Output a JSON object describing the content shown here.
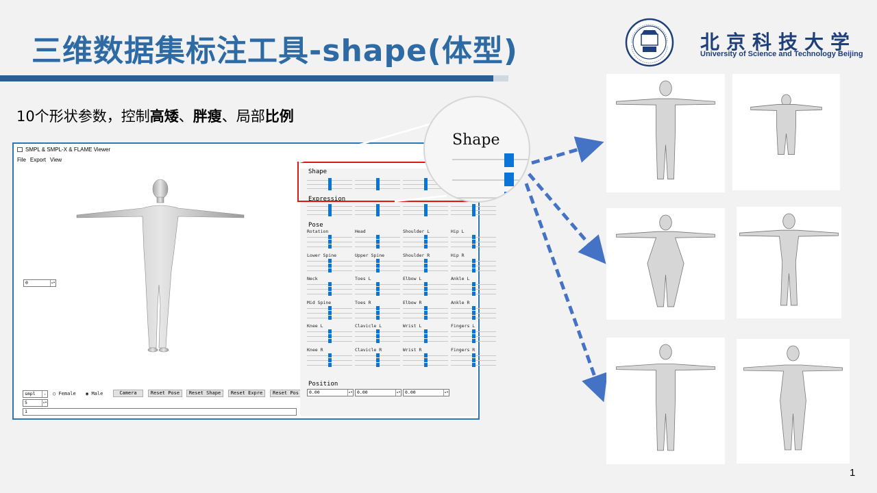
{
  "slide": {
    "title": "三维数据集标注工具-shape(体型)",
    "subtitle_parts": [
      "10个形状参数，控制",
      "高矮",
      "、",
      "胖瘦",
      "、局部",
      "比例"
    ],
    "page_number": "1"
  },
  "university": {
    "name_cn": "北京科技大学",
    "name_en": "University of Science and Technology Beijing",
    "seal_text": "北京科技大学 · 1952 · UNIVERSITY OF SCIENCE AND TECHNOLOGY BEIJING",
    "seal_center": "求实鼎新"
  },
  "app": {
    "window_title": "SMPL & SMPL-X & FLAME Viewer",
    "menu": [
      "File",
      "Export",
      "View"
    ],
    "frame_spin_value": "0",
    "model_select": "smpl",
    "gender_female": "Female",
    "gender_male": "Male",
    "buttons": [
      "Camera",
      "Reset Pose",
      "Reset Shape",
      "Reset Expre",
      "Reset Pos"
    ],
    "small_spin_value": "5",
    "text_field_value": "1",
    "shape_label": "Shape",
    "expression_label": "Expression",
    "pose_label": "Pose",
    "joints": [
      "Rotation",
      "Head",
      "Shoulder L",
      "Hip L",
      "Lower Spine",
      "Upper Spine",
      "Shoulder R",
      "Hip R",
      "Neck",
      "Toes L",
      "Elbow L",
      "Ankle L",
      "Mid Spine",
      "Toes R",
      "Elbow R",
      "Ankle R",
      "Knee L",
      "Clavicle L",
      "Wrist L",
      "Fingers L",
      "Knee R",
      "Clavicle R",
      "Wrist R",
      "Fingers R"
    ],
    "position_label": "Position",
    "position_values": [
      "0.00",
      "0.00",
      "0.00"
    ]
  },
  "zoom": {
    "label": "Shape"
  },
  "colors": {
    "title": "#2e6aa3",
    "accent_bar": "#2c5f93",
    "slider_thumb": "#0a75d6",
    "highlight": "#e01515",
    "arrow": "#4472c4"
  }
}
